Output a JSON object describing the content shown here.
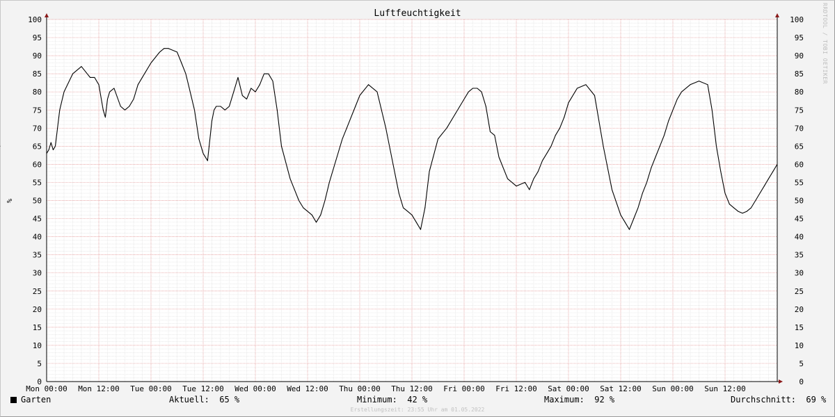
{
  "chart_data": {
    "type": "line",
    "title": "Luftfeuchtigkeit",
    "ylabel": "%",
    "ylim": [
      0,
      100
    ],
    "yticks": [
      0,
      5,
      10,
      15,
      20,
      25,
      30,
      35,
      40,
      45,
      50,
      55,
      60,
      65,
      70,
      75,
      80,
      85,
      90,
      95,
      100
    ],
    "xticks": [
      "Mon 00:00",
      "Mon 12:00",
      "Tue 00:00",
      "Tue 12:00",
      "Wed 00:00",
      "Wed 12:00",
      "Thu 00:00",
      "Thu 12:00",
      "Fri 00:00",
      "Fri 12:00",
      "Sat 00:00",
      "Sat 12:00",
      "Sun 00:00",
      "Sun 12:00"
    ],
    "grid": true,
    "series": [
      {
        "name": "Garten",
        "color": "#000000",
        "x_hours": [
          0,
          0.5,
          1,
          1.5,
          2,
          3,
          4,
          6,
          8,
          10,
          11,
          12,
          13,
          13.5,
          14,
          14.5,
          15.5,
          17,
          18,
          19,
          20,
          21,
          22.5,
          24,
          26,
          27,
          28,
          30,
          31,
          32,
          33,
          34,
          35,
          36,
          37,
          38,
          38.5,
          39,
          40,
          41,
          42,
          43,
          44,
          45,
          46,
          47,
          48,
          49,
          50,
          50.5,
          51,
          52,
          53,
          54,
          56,
          57,
          58,
          59,
          60,
          61,
          62,
          63,
          64,
          65,
          66,
          68,
          69,
          70,
          71,
          72,
          74,
          76,
          78,
          80,
          81,
          82,
          83,
          84,
          85,
          86,
          87,
          88,
          90,
          92,
          94,
          96,
          97,
          98,
          99,
          100,
          101,
          102,
          103,
          104,
          106,
          108,
          110,
          111,
          112,
          113,
          114,
          115,
          116,
          117,
          118,
          119,
          120,
          122,
          124,
          126,
          128,
          130,
          132,
          133,
          134,
          135,
          136,
          137,
          138,
          139,
          140,
          141,
          142,
          143,
          144,
          145,
          146,
          148,
          150,
          152,
          153,
          154,
          155,
          156,
          157,
          158,
          159,
          160,
          161,
          162,
          163,
          164,
          165,
          166,
          167,
          168
        ],
        "values": [
          63,
          64,
          66,
          64,
          65,
          75,
          80,
          85,
          87,
          84,
          84,
          82,
          75,
          73,
          78,
          80,
          81,
          76,
          75,
          76,
          78,
          82,
          85,
          88,
          91,
          92,
          92,
          91,
          88,
          85,
          80,
          75,
          67,
          63,
          61,
          72,
          75,
          76,
          76,
          75,
          76,
          80,
          84,
          79,
          78,
          81,
          80,
          82,
          85,
          85,
          85,
          83,
          75,
          65,
          56,
          53,
          50,
          48,
          47,
          46,
          44,
          46,
          50,
          55,
          59,
          67,
          70,
          73,
          76,
          79,
          82,
          80,
          70,
          58,
          52,
          48,
          47,
          46,
          44,
          42,
          48,
          58,
          67,
          70,
          74,
          78,
          80,
          81,
          81,
          80,
          76,
          69,
          68,
          62,
          56,
          54,
          55,
          53,
          56,
          58,
          61,
          63,
          65,
          68,
          70,
          73,
          77,
          81,
          82,
          79,
          65,
          53,
          46,
          44,
          42,
          45,
          48,
          52,
          55,
          59,
          62,
          65,
          68,
          72,
          75,
          78,
          80,
          82,
          83,
          82,
          75,
          65,
          58,
          52,
          49,
          48,
          47,
          46.5,
          47,
          48,
          50,
          52,
          54,
          56,
          58,
          60,
          65
        ]
      }
    ]
  },
  "legend": {
    "series_name": "Garten",
    "current_label": "Aktuell:",
    "current_value": "65 %",
    "min_label": "Minimum:",
    "min_value": "42 %",
    "max_label": "Maximum:",
    "max_value": "92 %",
    "avg_label": "Durchschnitt:",
    "avg_value": "69 %"
  },
  "footer": "Erstellungszeit: 23:55 Uhr am 01.05.2022",
  "watermark": "RRDTOOL / TOBI OETIKER"
}
